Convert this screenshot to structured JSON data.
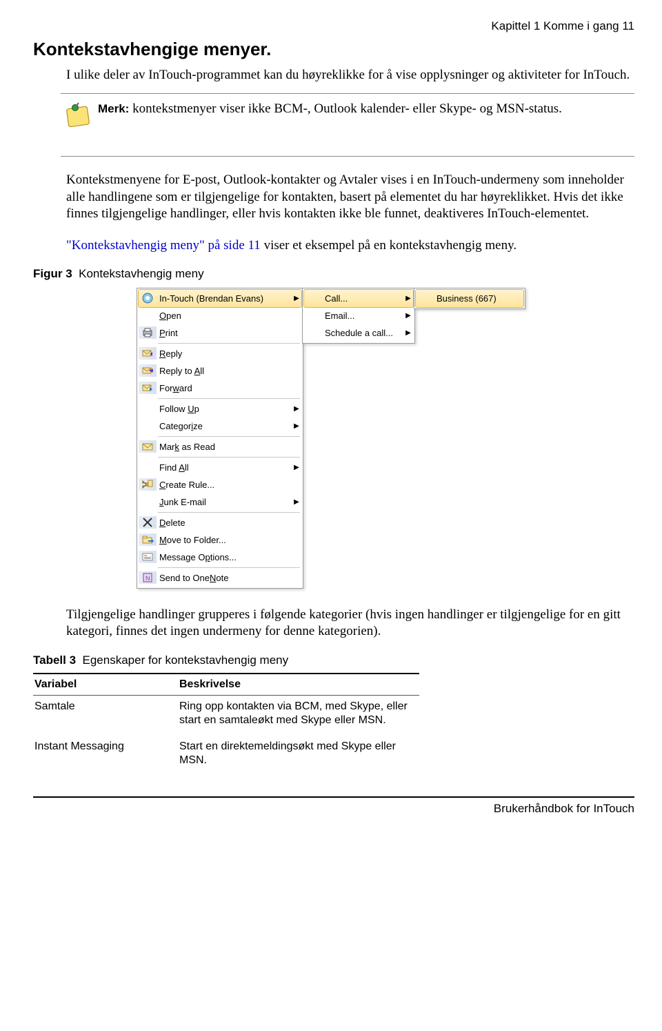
{
  "header": {
    "chapter_line": "Kapittel 1  Komme i gang  11"
  },
  "section_title": "Kontekstavhengige menyer.",
  "intro": "I ulike deler av InTouch-programmet kan du høyreklikke for å vise opplysninger og aktiviteter for InTouch.",
  "note": {
    "label": "Merk:",
    "text": " kontekstmenyer viser ikke BCM-, Outlook kalender- eller Skype- og MSN-status."
  },
  "para1": "Kontekstmenyene for E-post, Outlook-kontakter og Avtaler vises i en InTouch-undermeny som inneholder alle handlingene som er tilgjengelige for kontakten, basert på elementet du har høyreklikket. Hvis det ikke finnes tilgjengelige handlinger, eller hvis kontakten ikke ble funnet, deaktiveres InTouch-elementet.",
  "para2_link": "\"Kontekstavhengig meny\" på side 11",
  "para2_rest": " viser et eksempel på en kontekstavhengig meny.",
  "figure": {
    "label": "Figur 3",
    "title": "Kontekstavhengig meny"
  },
  "menu": {
    "main": [
      {
        "label": "In-Touch (Brendan Evans)",
        "icon": "intouch-icon",
        "arrow": true,
        "highlight": true
      },
      {
        "label_pre": "",
        "ul": "O",
        "label_post": "pen",
        "icon": "",
        "arrow": false
      },
      {
        "label_pre": "",
        "ul": "P",
        "label_post": "rint",
        "icon": "print-icon",
        "arrow": false,
        "sep_after": true
      },
      {
        "label_pre": "",
        "ul": "R",
        "label_post": "eply",
        "icon": "reply-icon",
        "arrow": false
      },
      {
        "label_pre": "Reply to ",
        "ul": "A",
        "label_post": "ll",
        "icon": "replyall-icon",
        "arrow": false
      },
      {
        "label_pre": "For",
        "ul": "w",
        "label_post": "ard",
        "icon": "forward-icon",
        "arrow": false,
        "sep_after": true
      },
      {
        "label_pre": "Follow ",
        "ul": "U",
        "label_post": "p",
        "icon": "",
        "arrow": true
      },
      {
        "label_pre": "Categor",
        "ul": "i",
        "label_post": "ze",
        "icon": "",
        "arrow": true,
        "sep_after": true
      },
      {
        "label_pre": "Mar",
        "ul": "k",
        "label_post": " as Read",
        "icon": "markread-icon",
        "arrow": false,
        "sep_after": true
      },
      {
        "label_pre": "Find ",
        "ul": "A",
        "label_post": "ll",
        "icon": "",
        "arrow": true
      },
      {
        "label_pre": "",
        "ul": "C",
        "label_post": "reate Rule...",
        "icon": "createrule-icon",
        "arrow": false
      },
      {
        "label_pre": "",
        "ul": "J",
        "label_post": "unk E-mail",
        "icon": "",
        "arrow": true,
        "sep_after": true
      },
      {
        "label_pre": "",
        "ul": "D",
        "label_post": "elete",
        "icon": "delete-icon",
        "arrow": false
      },
      {
        "label_pre": "",
        "ul": "M",
        "label_post": "ove to Folder...",
        "icon": "movefolder-icon",
        "arrow": false
      },
      {
        "label_pre": "Message O",
        "ul": "p",
        "label_post": "tions...",
        "icon": "msgoptions-icon",
        "arrow": false,
        "sep_after": true
      },
      {
        "label_pre": "Send to One",
        "ul": "N",
        "label_post": "ote",
        "icon": "onenote-icon",
        "arrow": false
      }
    ],
    "sub1": [
      {
        "label": "Call...",
        "arrow": true,
        "highlight": true
      },
      {
        "label": "Email...",
        "arrow": true
      },
      {
        "label": "Schedule a call...",
        "arrow": true
      }
    ],
    "sub2": [
      {
        "label": "Business (667)",
        "highlight": true
      }
    ]
  },
  "after_fig": "Tilgjengelige handlinger grupperes i følgende kategorier (hvis ingen handlinger er tilgjengelige for en gitt kategori, finnes det ingen undermeny for denne kategorien).",
  "table": {
    "label": "Tabell 3",
    "title": "Egenskaper for kontekstavhengig meny",
    "head": {
      "col1": "Variabel",
      "col2": "Beskrivelse"
    },
    "rows": [
      {
        "c1": "Samtale",
        "c2": "Ring opp kontakten via BCM, med Skype, eller start en samtaleøkt med Skype eller MSN."
      },
      {
        "c1": "Instant Messaging",
        "c2": "Start en direktemeldingsøkt med Skype eller MSN."
      }
    ]
  },
  "footer": "Brukerhåndbok for InTouch"
}
